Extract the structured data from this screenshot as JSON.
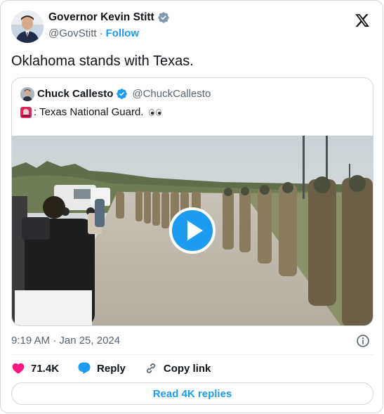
{
  "author": {
    "name": "Governor Kevin Stitt",
    "handle": "@GovStitt",
    "separator": "·",
    "follow_label": "Follow"
  },
  "tweet": {
    "text": "Oklahoma stands with Texas.",
    "timestamp": "9:19 AM · Jan 25, 2024"
  },
  "quoted": {
    "name": "Chuck Callesto",
    "handle": "@ChuckCallesto",
    "text": ": Texas National Guard.",
    "emoji_lead": "police-light",
    "emoji_trail": "eyes"
  },
  "actions": {
    "likes": "71.4K",
    "reply_label": "Reply",
    "copy_label": "Copy link",
    "read_replies_label": "Read 4K replies"
  },
  "colors": {
    "accent": "#1d9bf0",
    "like": "#f91880",
    "muted": "#536471",
    "border": "#cfd9de"
  }
}
